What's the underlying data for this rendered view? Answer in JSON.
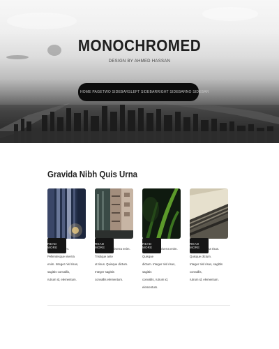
{
  "site": {
    "title": "MONOCHROMED",
    "tagline": "DESIGN BY AHMED HASSAN"
  },
  "nav": {
    "items": [
      "HOME PAGE",
      "TWO SIDEBARS",
      "LEFT SIDEBAR",
      "RIGHT SIDEBAR",
      "NO SIDEBAR"
    ]
  },
  "section": {
    "heading": "Gravida Nibh Quis Urna"
  },
  "posts": [
    {
      "lines": [
        "Quisque dictum. Pellentesque viverra",
        "enim. Integer nisl risus, sagittis convallis,",
        "rutrum id, elementum."
      ],
      "read_more": "READ MORE"
    },
    {
      "lines": [
        "Pellentesque viverra enim. Tristique ante",
        "ut risus. Quisque dictum. Integer sagittis",
        "convallis elementum."
      ],
      "read_more": "READ MORE"
    },
    {
      "lines": [
        "Pellentesque viverra enim. Quisque",
        "dictum. Integer nisl risus, sagittis",
        "convallis, rutrum id, elementum."
      ],
      "read_more": "READ MORE"
    },
    {
      "lines": [
        "Tristique ante ut risus. Quisque dictum.",
        "Integer nisl risus, sagittis convallis,",
        "rutrum id, elementum."
      ],
      "read_more": "READ MORE"
    }
  ]
}
